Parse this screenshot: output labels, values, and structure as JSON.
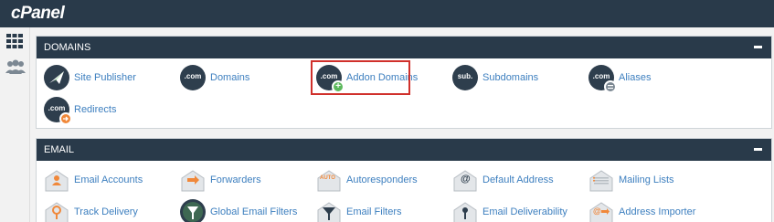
{
  "app": {
    "logo": "cPanel"
  },
  "leftnav": {
    "items": [
      {
        "icon": "grid-icon"
      },
      {
        "icon": "users-icon"
      }
    ]
  },
  "sections": {
    "domains": {
      "title": "DOMAINS",
      "items": [
        {
          "label": "Site Publisher",
          "icon": "site-publisher-icon"
        },
        {
          "label": "Domains",
          "icon": "domains-icon"
        },
        {
          "label": "Addon Domains",
          "icon": "addon-domains-icon"
        },
        {
          "label": "Subdomains",
          "icon": "subdomains-icon"
        },
        {
          "label": "Aliases",
          "icon": "aliases-icon"
        },
        {
          "label": "Redirects",
          "icon": "redirects-icon"
        }
      ]
    },
    "email": {
      "title": "EMAIL",
      "items": [
        {
          "label": "Email Accounts",
          "icon": "email-accounts-icon"
        },
        {
          "label": "Forwarders",
          "icon": "forwarders-icon"
        },
        {
          "label": "Autoresponders",
          "icon": "autoresponders-icon"
        },
        {
          "label": "Default Address",
          "icon": "default-address-icon"
        },
        {
          "label": "Mailing Lists",
          "icon": "mailing-lists-icon"
        },
        {
          "label": "Track Delivery",
          "icon": "track-delivery-icon"
        },
        {
          "label": "Global Email Filters",
          "icon": "global-email-filters-icon"
        },
        {
          "label": "Email Filters",
          "icon": "email-filters-icon"
        },
        {
          "label": "Email Deliverability",
          "icon": "email-deliverability-icon"
        },
        {
          "label": "Address Importer",
          "icon": "address-importer-icon"
        }
      ]
    }
  },
  "icon_text": {
    "com": ".com",
    "sub": "sub.",
    "auto": "AUTO",
    "at": "@",
    "plus": "+"
  },
  "colors": {
    "header_bg": "#293a4a",
    "link": "#3d7fbf",
    "highlight": "#d0302b",
    "badge_add": "#5cb85c",
    "badge_redirect": "#f0883a",
    "orange": "#f0883a"
  }
}
